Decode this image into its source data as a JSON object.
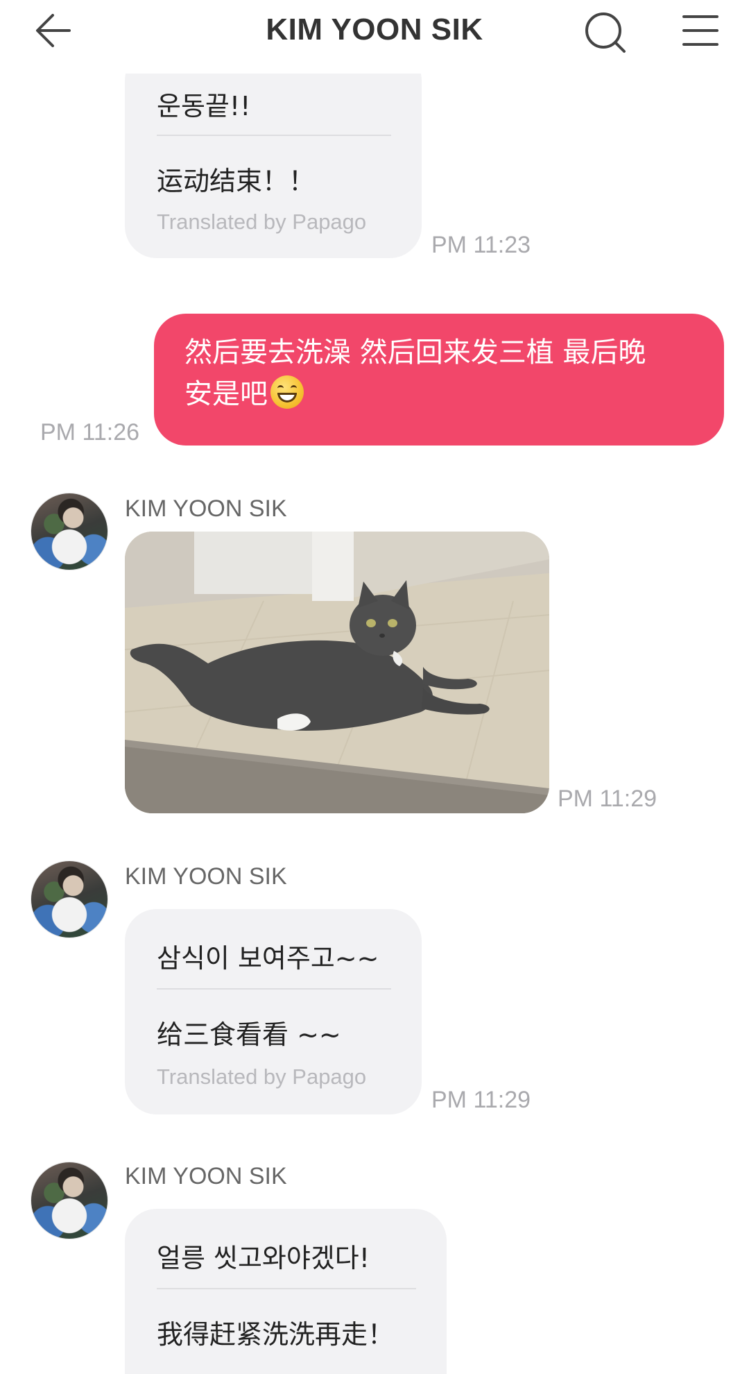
{
  "header": {
    "title": "KIM YOON SIK"
  },
  "messages": [
    {
      "type": "incoming",
      "original": "운동끝!!",
      "translation": "运动结束！！",
      "translated_by": "Translated by Papago",
      "time": "PM 11:23"
    },
    {
      "type": "outgoing",
      "text_line1": "然后要去洗澡 然后回来发三植 最后晚",
      "text_line2": "安是吧",
      "emoji": "grinning-face",
      "time": "PM 11:26"
    },
    {
      "type": "incoming-image",
      "sender": "KIM YOON SIK",
      "image": "gray-cat-lying-on-floor",
      "time": "PM 11:29"
    },
    {
      "type": "incoming",
      "sender": "KIM YOON SIK",
      "original": "삼식이 보여주고~~",
      "translation": "给三食看看 ~~",
      "translated_by": "Translated by Papago",
      "time": "PM 11:29"
    },
    {
      "type": "incoming",
      "sender": "KIM YOON SIK",
      "original": "얼릉 씻고와야겠다!",
      "translation": "我得赶紧洗洗再走！"
    }
  ],
  "colors": {
    "outgoing_bubble": "#f2476a",
    "incoming_bubble": "#f2f2f4",
    "timestamp": "#a9a9ad"
  }
}
